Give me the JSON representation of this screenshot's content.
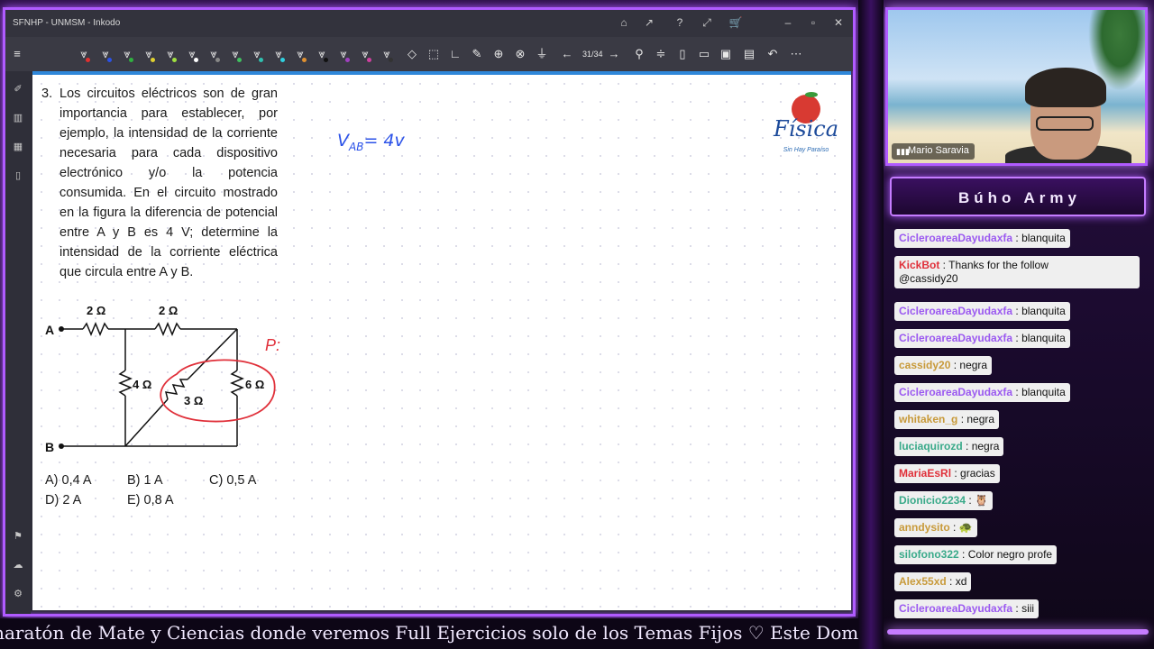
{
  "window": {
    "title": "SFNHP - UNMSM - Inkodo"
  },
  "toolbar": {
    "page_counter": "31/34"
  },
  "problem": {
    "number": "3.",
    "text": "Los circuitos eléctricos son de gran importancia para establecer, por ejemplo, la intensidad de la corriente necesaria para cada dispositivo electrónico y/o la potencia consumida. En el circuito mostrado en la figura la diferencia de potencial entre A y B es 4 V; determine la intensidad de la corriente eléctrica que circula entre A y B.",
    "choices": [
      "A) 0,4 A",
      "B) 1 A",
      "C) 0,5 A",
      "D) 2 A",
      "E) 0,8 A"
    ]
  },
  "circuit": {
    "node_a": "A",
    "node_b": "B",
    "r_top_left": "2 Ω",
    "r_top_right": "2 Ω",
    "r_middle": "4 Ω",
    "r_diagonal": "3 Ω",
    "r_right": "6 Ω"
  },
  "annotations": {
    "handwriting": "VAB = 4v",
    "handwriting_main": "V",
    "handwriting_sub": "AB",
    "handwriting_rest": "= 4v",
    "red_mark": "P:"
  },
  "logo": {
    "text": "Física",
    "subtext": "Sin Hay Paraíso"
  },
  "webcam": {
    "name": "Mario Saravia"
  },
  "chat": {
    "title": "Búho Army",
    "messages": [
      {
        "user": "CicleroareaDayudaxfa",
        "text": "blanquita",
        "color": "#9b59f0"
      },
      {
        "user": "KickBot",
        "text": "Thanks for the follow",
        "text2": "@cassidy20",
        "color": "#e0303a"
      },
      {
        "user": "CicleroareaDayudaxfa",
        "text": "blanquita",
        "color": "#9b59f0"
      },
      {
        "user": "CicleroareaDayudaxfa",
        "text": "blanquita",
        "color": "#9b59f0"
      },
      {
        "user": "cassidy20",
        "text": "negra",
        "color": "#c89a3a"
      },
      {
        "user": "CicleroareaDayudaxfa",
        "text": "blanquita",
        "color": "#9b59f0"
      },
      {
        "user": "whitaken_g",
        "text": "negra",
        "color": "#c89a3a"
      },
      {
        "user": "luciaquirozd",
        "text": "negra",
        "color": "#3aaa8a"
      },
      {
        "user": "MariaEsRl",
        "text": "gracias",
        "color": "#e0303a"
      },
      {
        "user": "Dionicio2234",
        "text": "🦉",
        "color": "#3aaa8a"
      },
      {
        "user": "anndysito",
        "text": "🐢",
        "color": "#c89a3a"
      },
      {
        "user": "silofono322",
        "text": "Color negro profe",
        "color": "#3aaa8a"
      },
      {
        "user": "Alex55xd",
        "text": "xd",
        "color": "#c89a3a"
      },
      {
        "user": "CicleroareaDayudaxfa",
        "text": "siii",
        "color": "#9b59f0"
      }
    ]
  },
  "ticker": {
    "text": "maratón de Mate y Ciencias donde veremos Full Ejercicios solo de los Temas Fijos ♡  Este Domin"
  }
}
